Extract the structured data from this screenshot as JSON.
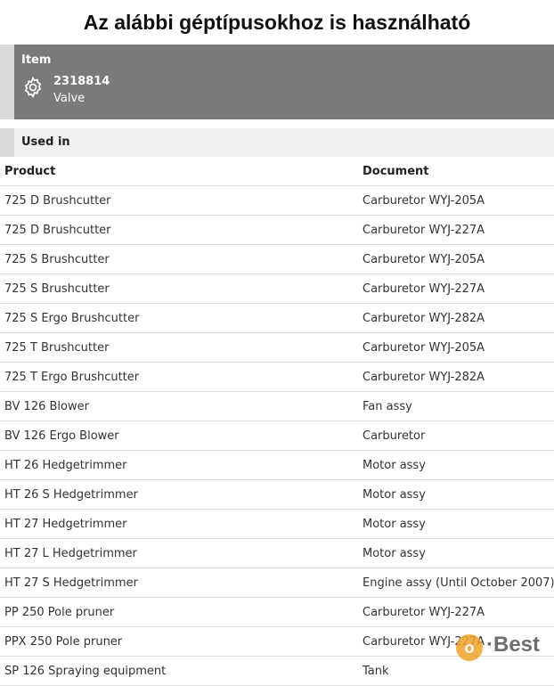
{
  "page_title": "Az alábbi géptípusokhoz is használható",
  "item": {
    "heading": "Item",
    "number": "2318814",
    "name": "Valve",
    "icon": "gear-icon"
  },
  "used_in": {
    "heading": "Used in",
    "columns": [
      "Product",
      "Document"
    ],
    "rows": [
      [
        "725 D Brushcutter",
        "Carburetor WYJ-205A"
      ],
      [
        "725 D Brushcutter",
        "Carburetor WYJ-227A"
      ],
      [
        "725 S Brushcutter",
        "Carburetor WYJ-205A"
      ],
      [
        "725 S Brushcutter",
        "Carburetor WYJ-227A"
      ],
      [
        "725 S Ergo Brushcutter",
        "Carburetor WYJ-282A"
      ],
      [
        "725 T Brushcutter",
        "Carburetor WYJ-205A"
      ],
      [
        "725 T Ergo Brushcutter",
        "Carburetor WYJ-282A"
      ],
      [
        "BV 126 Blower",
        "Fan assy"
      ],
      [
        "BV 126 Ergo Blower",
        "Carburetor"
      ],
      [
        "HT 26 Hedgetrimmer",
        "Motor assy"
      ],
      [
        "HT 26 S Hedgetrimmer",
        "Motor assy"
      ],
      [
        "HT 27 Hedgetrimmer",
        "Motor assy"
      ],
      [
        "HT 27 L Hedgetrimmer",
        "Motor assy"
      ],
      [
        "HT 27 S Hedgetrimmer",
        "Engine assy (Until October 2007)"
      ],
      [
        "PP 250 Pole pruner",
        "Carburetor WYJ-227A"
      ],
      [
        "PPX 250 Pole pruner",
        "Carburetor WYJ-227A"
      ],
      [
        "SP 126 Spraying equipment",
        "Tank"
      ]
    ]
  },
  "watermark": {
    "letter": "o",
    "text": "·Best"
  }
}
